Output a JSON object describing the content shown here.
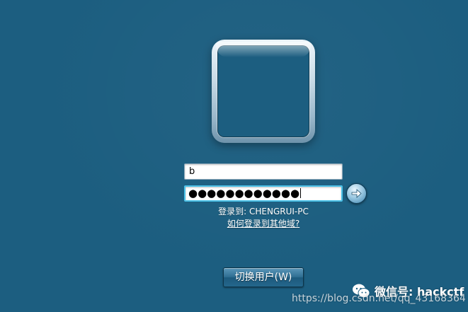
{
  "login": {
    "username_value": "b",
    "password_mask": "●●●●●●●●●●●●",
    "login_to_text": "登录到: CHENGRUI-PC",
    "other_domain_link": "如何登录到其他域?",
    "switch_user_label": "切换用户(W)",
    "submit_icon": "arrow-right-icon"
  },
  "watermarks": {
    "wechat_label": "微信号: hackctf",
    "wechat_icon": "wechat-icon",
    "csdn_url": "https://blog.csdn.net/qq_43168364"
  },
  "colors": {
    "background": "#1c5e80",
    "focus_border": "#4cc2e8",
    "text": "#ffffff"
  }
}
